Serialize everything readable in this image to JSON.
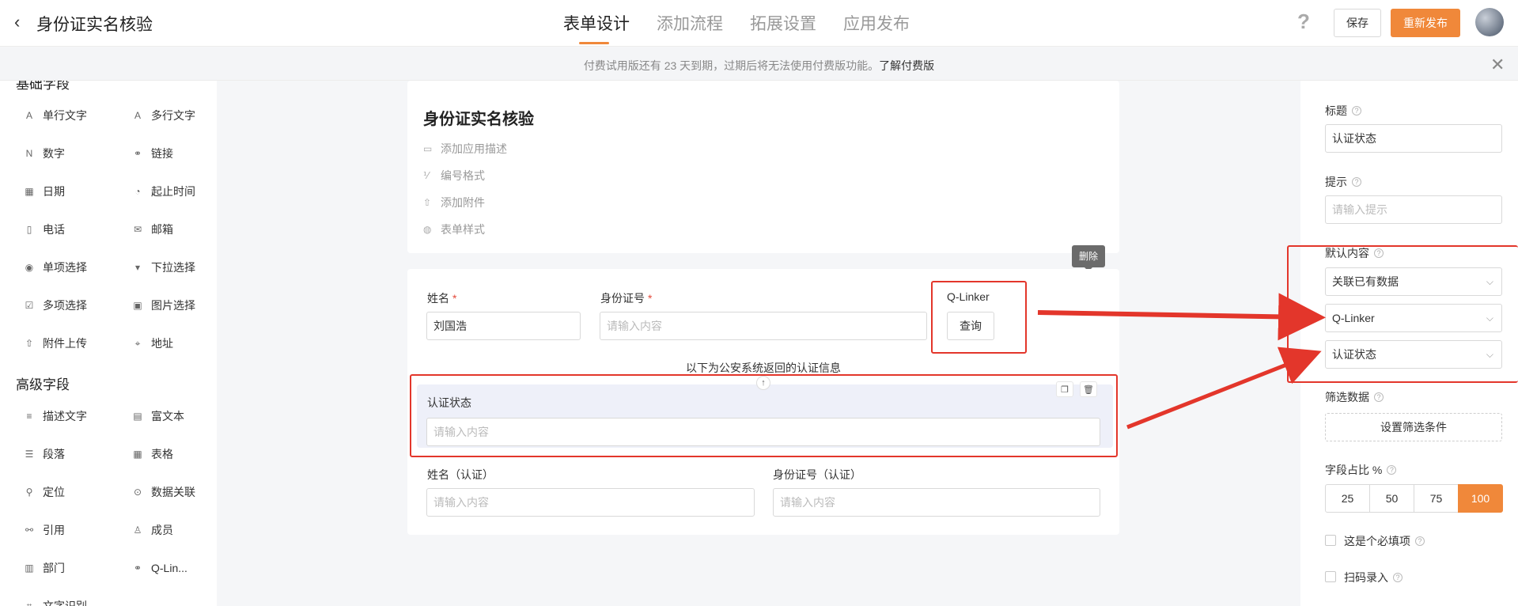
{
  "header": {
    "title": "身份证实名核验",
    "tabs": [
      "表单设计",
      "添加流程",
      "拓展设置",
      "应用发布"
    ],
    "help": "?",
    "save_label": "保存",
    "republish_label": "重新发布"
  },
  "notice": {
    "text": "付费试用版还有 23 天到期，过期后将无法使用付费版功能。",
    "link": "了解付费版"
  },
  "sidebar": {
    "basic_title": "基础字段",
    "basic_items": [
      {
        "label": "单行文字",
        "icon": "single-line-text-icon",
        "glyph": "A"
      },
      {
        "label": "多行文字",
        "icon": "multi-line-text-icon",
        "glyph": "A"
      },
      {
        "label": "数字",
        "icon": "number-icon",
        "glyph": "N"
      },
      {
        "label": "链接",
        "icon": "link-icon",
        "glyph": "⚭"
      },
      {
        "label": "日期",
        "icon": "date-icon",
        "glyph": "▦"
      },
      {
        "label": "起止时间",
        "icon": "time-range-icon",
        "glyph": "◔"
      },
      {
        "label": "电话",
        "icon": "phone-icon",
        "glyph": "▯"
      },
      {
        "label": "邮箱",
        "icon": "mail-icon",
        "glyph": "✉"
      },
      {
        "label": "单项选择",
        "icon": "radio-icon",
        "glyph": "◉"
      },
      {
        "label": "下拉选择",
        "icon": "dropdown-icon",
        "glyph": "▾"
      },
      {
        "label": "多项选择",
        "icon": "checkbox-icon",
        "glyph": "☑"
      },
      {
        "label": "图片选择",
        "icon": "image-select-icon",
        "glyph": "▣"
      },
      {
        "label": "附件上传",
        "icon": "upload-icon",
        "glyph": "⇧"
      },
      {
        "label": "地址",
        "icon": "address-icon",
        "glyph": "⌖"
      }
    ],
    "advanced_title": "高级字段",
    "advanced_items": [
      {
        "label": "描述文字",
        "icon": "description-icon",
        "glyph": "≡"
      },
      {
        "label": "富文本",
        "icon": "rich-text-icon",
        "glyph": "▤"
      },
      {
        "label": "段落",
        "icon": "paragraph-icon",
        "glyph": "☰"
      },
      {
        "label": "表格",
        "icon": "table-icon",
        "glyph": "▦"
      },
      {
        "label": "定位",
        "icon": "location-icon",
        "glyph": "⚲"
      },
      {
        "label": "数据关联",
        "icon": "data-link-icon",
        "glyph": "⊙"
      },
      {
        "label": "引用",
        "icon": "reference-icon",
        "glyph": "⚯"
      },
      {
        "label": "成员",
        "icon": "member-icon",
        "glyph": "♙"
      },
      {
        "label": "部门",
        "icon": "department-icon",
        "glyph": "▥"
      },
      {
        "label": "Q-Lin...",
        "icon": "q-linker-icon",
        "glyph": "⚭"
      },
      {
        "label": "文字识别",
        "icon": "ocr-icon",
        "glyph": "⌗"
      }
    ]
  },
  "form_header": {
    "title": "身份证实名核验",
    "meta": [
      {
        "label": "添加应用描述",
        "icon": "comment-icon",
        "glyph": "▭"
      },
      {
        "label": "编号格式",
        "icon": "numbering-icon",
        "glyph": "⅟"
      },
      {
        "label": "添加附件",
        "icon": "attachment-icon",
        "glyph": "⇧"
      },
      {
        "label": "表单样式",
        "icon": "palette-icon",
        "glyph": "◍"
      }
    ]
  },
  "form_body": {
    "name_label": "姓名",
    "name_value": "刘国浩",
    "id_label": "身份证号",
    "id_placeholder": "请输入内容",
    "required_mark": "*",
    "qlinker_label": "Q-Linker",
    "query_label": "查询",
    "delete_tooltip": "删除",
    "caption": "以下为公安系统返回的认证信息",
    "auth_status_label": "认证状态",
    "auth_status_placeholder": "请输入内容",
    "verified_name_label": "姓名（认证）",
    "verified_name_placeholder": "请输入内容",
    "verified_id_label": "身份证号（认证）",
    "verified_id_placeholder": "请输入内容"
  },
  "right_panel": {
    "title_label": "标题",
    "title_value": "认证状态",
    "hint_label": "提示",
    "hint_placeholder": "请输入提示",
    "default_label": "默认内容",
    "default_select_1": "关联已有数据",
    "default_select_2": "Q-Linker",
    "default_select_3": "认证状态",
    "filter_label": "筛选数据",
    "filter_button": "设置筛选条件",
    "width_label": "字段占比 %",
    "width_options": [
      "25",
      "50",
      "75",
      "100"
    ],
    "width_selected": "100",
    "required_checkbox_label": "这是个必填项",
    "scan_checkbox_label": "扫码录入"
  },
  "colors": {
    "accent": "#f0883a",
    "annotation_red": "#e3362b",
    "selected_bg": "#eef0f9"
  }
}
